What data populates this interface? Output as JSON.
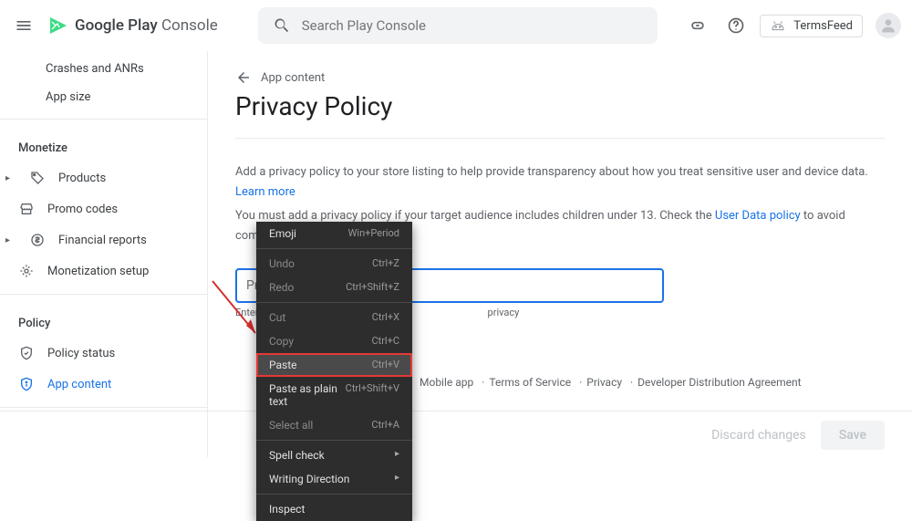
{
  "header": {
    "logo_google": "Google",
    "logo_play": "Play",
    "logo_console": "Console",
    "search_placeholder": "Search Play Console",
    "developer_name": "TermsFeed"
  },
  "sidebar": {
    "items_top": [
      {
        "label": "Crashes and ANRs"
      },
      {
        "label": "App size"
      }
    ],
    "section_monetize": "Monetize",
    "items_monetize": [
      {
        "label": "Products"
      },
      {
        "label": "Promo codes"
      },
      {
        "label": "Financial reports"
      },
      {
        "label": "Monetization setup"
      }
    ],
    "section_policy": "Policy",
    "items_policy": [
      {
        "label": "Policy status"
      },
      {
        "label": "App content"
      }
    ]
  },
  "main": {
    "breadcrumb_label": "App content",
    "page_title": "Privacy Policy",
    "desc_line1_a": "Add a privacy policy to your store listing to help provide transparency about how you treat sensitive user and device data. ",
    "desc_line1_link": "Learn more",
    "desc_line2_a": "You must add a privacy policy if your target audience includes children under 13. Check the ",
    "desc_line2_link": "User Data policy",
    "desc_line2_b": " to avoid common violations.",
    "url_placeholder": "Privacy policy URL",
    "url_hint_prefix": "Enter",
    "url_hint_suffix": "privacy",
    "footer": [
      "Mobile app",
      "Terms of Service",
      "Privacy",
      "Developer Distribution Agreement"
    ],
    "discard_label": "Discard changes",
    "save_label": "Save"
  },
  "context_menu": {
    "items": [
      {
        "label": "Emoji",
        "shortcut": "Win+Period"
      },
      "divider",
      {
        "label": "Undo",
        "shortcut": "Ctrl+Z",
        "disabled": true
      },
      {
        "label": "Redo",
        "shortcut": "Ctrl+Shift+Z",
        "disabled": true
      },
      "divider",
      {
        "label": "Cut",
        "shortcut": "Ctrl+X",
        "disabled": true
      },
      {
        "label": "Copy",
        "shortcut": "Ctrl+C",
        "disabled": true
      },
      {
        "label": "Paste",
        "shortcut": "Ctrl+V",
        "highlight": true,
        "box": true
      },
      {
        "label": "Paste as plain text",
        "shortcut": "Ctrl+Shift+V"
      },
      {
        "label": "Select all",
        "shortcut": "Ctrl+A",
        "disabled": true
      },
      "divider",
      {
        "label": "Spell check",
        "sub": true
      },
      {
        "label": "Writing Direction",
        "sub": true
      },
      "divider",
      {
        "label": "Inspect"
      }
    ]
  }
}
